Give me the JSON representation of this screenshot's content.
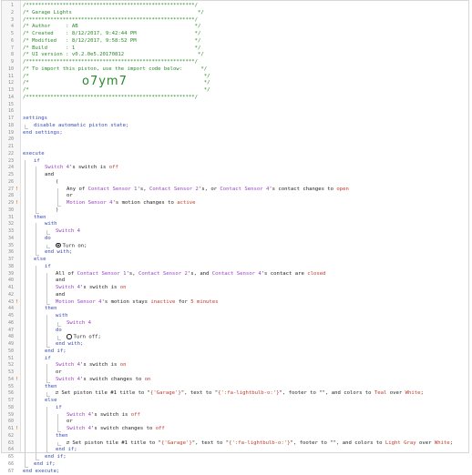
{
  "editor": {
    "lines": [
      {
        "n": "1",
        "indent": 0,
        "tokens": [
          {
            "t": "/*******************************************************/",
            "c": "cm"
          }
        ]
      },
      {
        "n": "2",
        "indent": 0,
        "tokens": [
          {
            "t": "/* Garage Lights                                         */",
            "c": "cm"
          }
        ]
      },
      {
        "n": "3",
        "indent": 0,
        "tokens": [
          {
            "t": "/*******************************************************/",
            "c": "cm"
          }
        ]
      },
      {
        "n": "4",
        "indent": 0,
        "tokens": [
          {
            "t": "/* Author     : AB                                      */",
            "c": "cm"
          }
        ]
      },
      {
        "n": "5",
        "indent": 0,
        "tokens": [
          {
            "t": "/* Created    : 8/12/2017, 9:42:44 PM                   */",
            "c": "cm"
          }
        ]
      },
      {
        "n": "6",
        "indent": 0,
        "tokens": [
          {
            "t": "/* Modified   : 8/12/2017, 9:58:52 PM                   */",
            "c": "cm"
          }
        ]
      },
      {
        "n": "7",
        "indent": 0,
        "tokens": [
          {
            "t": "/* Build      : 1                                       */",
            "c": "cm"
          }
        ]
      },
      {
        "n": "8",
        "indent": 0,
        "tokens": [
          {
            "t": "/* UI version : v0.2.0e5.20170812                        */",
            "c": "cm"
          }
        ]
      },
      {
        "n": "9",
        "indent": 0,
        "tokens": [
          {
            "t": "/*******************************************************/",
            "c": "cm"
          }
        ]
      },
      {
        "n": "10",
        "indent": 0,
        "tokens": [
          {
            "t": "/* To import this piston, use the import code below:      */",
            "c": "cm"
          }
        ]
      },
      {
        "n": "11",
        "indent": 0,
        "tokens": [
          {
            "t": "/*                                                         */",
            "c": "cm"
          }
        ]
      },
      {
        "n": "12",
        "indent": 0,
        "big": "o7ym7",
        "tokens": [
          {
            "t": "/*                                                         */",
            "c": "cm"
          }
        ]
      },
      {
        "n": "13",
        "indent": 0,
        "tokens": [
          {
            "t": "/*                                                         */",
            "c": "cm"
          }
        ]
      },
      {
        "n": "14",
        "indent": 0,
        "tokens": [
          {
            "t": "/*******************************************************/",
            "c": "cm"
          }
        ]
      },
      {
        "n": "15",
        "indent": 0,
        "tokens": []
      },
      {
        "n": "16",
        "indent": 0,
        "tokens": []
      },
      {
        "n": "17",
        "indent": 0,
        "tokens": [
          {
            "t": "settings",
            "c": "kw"
          }
        ]
      },
      {
        "n": "18",
        "indent": 1,
        "tokens": [
          {
            "t": "disable automatic piston state;",
            "c": "kw"
          }
        ]
      },
      {
        "n": "19",
        "indent": 0,
        "tokens": [
          {
            "t": "end settings;",
            "c": "kw"
          }
        ]
      },
      {
        "n": "20",
        "indent": 0,
        "tokens": []
      },
      {
        "n": "21",
        "indent": 0,
        "tokens": []
      },
      {
        "n": "22",
        "indent": 0,
        "tokens": [
          {
            "t": "execute",
            "c": "kw"
          }
        ]
      },
      {
        "n": "23",
        "indent": 1,
        "tokens": [
          {
            "t": "if",
            "c": "kw"
          }
        ]
      },
      {
        "n": "24",
        "indent": 2,
        "tokens": [
          {
            "t": "Switch 4",
            "c": "dev"
          },
          {
            "t": "'s switch is "
          },
          {
            "t": "off",
            "c": "lit"
          }
        ]
      },
      {
        "n": "25",
        "indent": 2,
        "tokens": [
          {
            "t": "and"
          }
        ]
      },
      {
        "n": "26",
        "indent": 3,
        "tokens": [
          {
            "t": "("
          }
        ]
      },
      {
        "n": "27",
        "indent": 4,
        "mark": true,
        "tokens": [
          {
            "t": "Any of "
          },
          {
            "t": "Contact Sensor 1",
            "c": "dev"
          },
          {
            "t": "'s, "
          },
          {
            "t": "Contact Sensor 2",
            "c": "dev"
          },
          {
            "t": "'s, or "
          },
          {
            "t": "Contact Sensor 4",
            "c": "dev"
          },
          {
            "t": "'s contact changes to "
          },
          {
            "t": "open",
            "c": "lit"
          }
        ]
      },
      {
        "n": "28",
        "indent": 4,
        "tokens": [
          {
            "t": "or"
          }
        ]
      },
      {
        "n": "29",
        "indent": 4,
        "mark": true,
        "tokens": [
          {
            "t": "Motion Sensor 4",
            "c": "dev"
          },
          {
            "t": "'s motion changes to "
          },
          {
            "t": "active",
            "c": "lit"
          }
        ]
      },
      {
        "n": "30",
        "indent": 3,
        "tokens": [
          {
            "t": ")"
          }
        ]
      },
      {
        "n": "31",
        "indent": 1,
        "tokens": [
          {
            "t": "then",
            "c": "kw"
          }
        ]
      },
      {
        "n": "32",
        "indent": 2,
        "tokens": [
          {
            "t": "with",
            "c": "kw"
          }
        ]
      },
      {
        "n": "33",
        "indent": 3,
        "tokens": [
          {
            "t": "Switch 4",
            "c": "dev"
          }
        ]
      },
      {
        "n": "34",
        "indent": 2,
        "tokens": [
          {
            "t": "do",
            "c": "kw"
          }
        ]
      },
      {
        "n": "35",
        "indent": 3,
        "icon": "fill",
        "tokens": [
          {
            "t": "Turn on;"
          }
        ]
      },
      {
        "n": "36",
        "indent": 2,
        "tokens": [
          {
            "t": "end with;",
            "c": "kw"
          }
        ]
      },
      {
        "n": "37",
        "indent": 1,
        "tokens": [
          {
            "t": "else",
            "c": "kw"
          }
        ]
      },
      {
        "n": "38",
        "indent": 2,
        "tokens": [
          {
            "t": "if",
            "c": "kw"
          }
        ]
      },
      {
        "n": "39",
        "indent": 3,
        "tokens": [
          {
            "t": "All of "
          },
          {
            "t": "Contact Sensor 1",
            "c": "dev"
          },
          {
            "t": "'s, "
          },
          {
            "t": "Contact Sensor 2",
            "c": "dev"
          },
          {
            "t": "'s, and "
          },
          {
            "t": "Contact Sensor 4",
            "c": "dev"
          },
          {
            "t": "'s contact are "
          },
          {
            "t": "closed",
            "c": "lit"
          }
        ]
      },
      {
        "n": "40",
        "indent": 3,
        "tokens": [
          {
            "t": "and"
          }
        ]
      },
      {
        "n": "41",
        "indent": 3,
        "tokens": [
          {
            "t": "Switch 4",
            "c": "dev"
          },
          {
            "t": "'s switch is "
          },
          {
            "t": "on",
            "c": "lit"
          }
        ]
      },
      {
        "n": "42",
        "indent": 3,
        "tokens": [
          {
            "t": "and"
          }
        ]
      },
      {
        "n": "43",
        "indent": 3,
        "mark": true,
        "tokens": [
          {
            "t": "Motion Sensor 4",
            "c": "dev"
          },
          {
            "t": "'s motion stays "
          },
          {
            "t": "inactive",
            "c": "lit"
          },
          {
            "t": " for "
          },
          {
            "t": "5 minutes",
            "c": "lit"
          }
        ]
      },
      {
        "n": "44",
        "indent": 2,
        "tokens": [
          {
            "t": "then",
            "c": "kw"
          }
        ]
      },
      {
        "n": "45",
        "indent": 3,
        "tokens": [
          {
            "t": "with",
            "c": "kw"
          }
        ]
      },
      {
        "n": "46",
        "indent": 4,
        "tokens": [
          {
            "t": "Switch 4",
            "c": "dev"
          }
        ]
      },
      {
        "n": "47",
        "indent": 3,
        "tokens": [
          {
            "t": "do",
            "c": "kw"
          }
        ]
      },
      {
        "n": "48",
        "indent": 4,
        "icon": "open",
        "tokens": [
          {
            "t": "Turn off;"
          }
        ]
      },
      {
        "n": "49",
        "indent": 3,
        "tokens": [
          {
            "t": "end with;",
            "c": "kw"
          }
        ]
      },
      {
        "n": "50",
        "indent": 2,
        "tokens": [
          {
            "t": "end if;",
            "c": "kw"
          }
        ]
      },
      {
        "n": "51",
        "indent": 2,
        "tokens": [
          {
            "t": "if",
            "c": "kw"
          }
        ]
      },
      {
        "n": "52",
        "indent": 3,
        "tokens": [
          {
            "t": "Switch 4",
            "c": "dev"
          },
          {
            "t": "'s switch is "
          },
          {
            "t": "on",
            "c": "lit"
          }
        ]
      },
      {
        "n": "53",
        "indent": 3,
        "tokens": [
          {
            "t": "or"
          }
        ]
      },
      {
        "n": "54",
        "indent": 3,
        "mark": true,
        "tokens": [
          {
            "t": "Switch 4",
            "c": "dev"
          },
          {
            "t": "'s switch changes to "
          },
          {
            "t": "on",
            "c": "lit"
          }
        ]
      },
      {
        "n": "55",
        "indent": 2,
        "tokens": [
          {
            "t": "then",
            "c": "kw"
          }
        ]
      },
      {
        "n": "56",
        "indent": 3,
        "icon": "bullet",
        "tokens": [
          {
            "t": "Set piston tile #1 title to \""
          },
          {
            "t": "{'Garage'}",
            "c": "lit"
          },
          {
            "t": "\", text to \""
          },
          {
            "t": "{':fa-lightbulb-o:'}",
            "c": "lit"
          },
          {
            "t": "\", footer to \"\", and colors to "
          },
          {
            "t": "Teal",
            "c": "lit"
          },
          {
            "t": " over "
          },
          {
            "t": "White",
            "c": "lit"
          },
          {
            "t": ";"
          }
        ]
      },
      {
        "n": "57",
        "indent": 2,
        "tokens": [
          {
            "t": "else",
            "c": "kw"
          }
        ]
      },
      {
        "n": "58",
        "indent": 3,
        "tokens": [
          {
            "t": "if",
            "c": "kw"
          }
        ]
      },
      {
        "n": "59",
        "indent": 4,
        "tokens": [
          {
            "t": "Switch 4",
            "c": "dev"
          },
          {
            "t": "'s switch is "
          },
          {
            "t": "off",
            "c": "lit"
          }
        ]
      },
      {
        "n": "60",
        "indent": 4,
        "tokens": [
          {
            "t": "or"
          }
        ]
      },
      {
        "n": "61",
        "indent": 4,
        "mark": true,
        "tokens": [
          {
            "t": "Switch 4",
            "c": "dev"
          },
          {
            "t": "'s switch changes to "
          },
          {
            "t": "off",
            "c": "lit"
          }
        ]
      },
      {
        "n": "62",
        "indent": 3,
        "tokens": [
          {
            "t": "then",
            "c": "kw"
          }
        ]
      },
      {
        "n": "63",
        "indent": 4,
        "icon": "bullet",
        "tokens": [
          {
            "t": "Set piston tile #1 title to \""
          },
          {
            "t": "{'Garage'}",
            "c": "lit"
          },
          {
            "t": "\", text to \""
          },
          {
            "t": "{':fa-lightbulb-o:'}",
            "c": "lit"
          },
          {
            "t": "\", footer to \"\", and colors to "
          },
          {
            "t": "Light Gray",
            "c": "lit"
          },
          {
            "t": " over "
          },
          {
            "t": "White",
            "c": "lit"
          },
          {
            "t": ";"
          }
        ]
      },
      {
        "n": "64",
        "indent": 3,
        "tokens": [
          {
            "t": "end if;",
            "c": "kw"
          }
        ]
      },
      {
        "n": "65",
        "indent": 2,
        "tokens": [
          {
            "t": "end if;",
            "c": "kw"
          }
        ]
      },
      {
        "n": "66",
        "indent": 1,
        "tokens": [
          {
            "t": "end if;",
            "c": "kw"
          }
        ]
      },
      {
        "n": "67",
        "indent": 0,
        "tokens": [
          {
            "t": "end execute;",
            "c": "kw"
          }
        ]
      }
    ],
    "mark_glyph": "!",
    "bullet_glyph": "⇄",
    "colors": {
      "comment": "#2a8a2a",
      "keyword": "#3548b5",
      "device": "#9a3fc4",
      "literal": "#c0392b",
      "gutter": "#f6f6f6",
      "mark": "#e07a20"
    }
  }
}
